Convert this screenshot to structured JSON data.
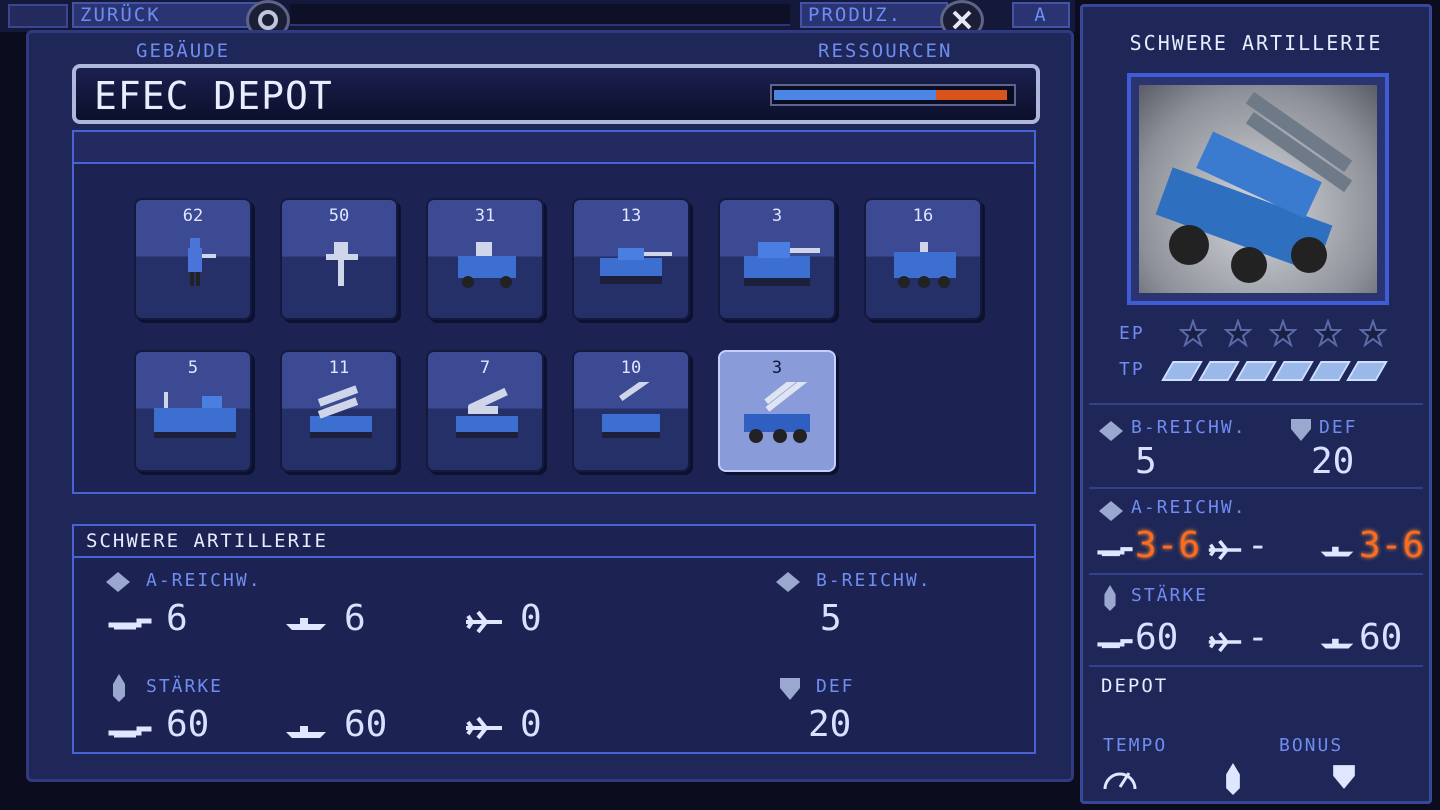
{
  "topbar": {
    "back_label": "ZURÜCK",
    "prod_label": "PRODUZ.",
    "a_label": "A"
  },
  "header": {
    "gebaeude_label": "GEBÄUDE",
    "ressourcen_label": "RESSOURCEN",
    "building_name": "EFEC DEPOT",
    "resource_blue_fraction": 0.68,
    "resource_orange_fraction": 0.3
  },
  "units": [
    {
      "count": "62",
      "type": "infantry"
    },
    {
      "count": "50",
      "type": "mech-infantry"
    },
    {
      "count": "31",
      "type": "jeep"
    },
    {
      "count": "13",
      "type": "light-tank"
    },
    {
      "count": "3",
      "type": "tank"
    },
    {
      "count": "16",
      "type": "apc"
    },
    {
      "count": "5",
      "type": "rocket-truck"
    },
    {
      "count": "11",
      "type": "multi-launcher"
    },
    {
      "count": "7",
      "type": "missile-tank"
    },
    {
      "count": "10",
      "type": "artillery"
    },
    {
      "count": "3",
      "type": "heavy-artillery",
      "selected": true
    }
  ],
  "detail": {
    "title": "SCHWERE ARTILLERIE",
    "a_range_label": "A-REICHW.",
    "a_range_ground": "6",
    "a_range_sea": "6",
    "a_range_air": "0",
    "b_range_label": "B-REICHW.",
    "b_range_value": "5",
    "strength_label": "STÄRKE",
    "strength_ground": "60",
    "strength_sea": "60",
    "strength_air": "0",
    "def_label": "DEF",
    "def_value": "20"
  },
  "right": {
    "title": "SCHWERE ARTILLERIE",
    "ep_label": "EP",
    "ep_stars": 5,
    "tp_label": "TP",
    "tp_segments": 6,
    "b_range_label": "B-REICHW.",
    "b_range_value": "5",
    "def_label": "DEF",
    "def_value": "20",
    "a_range_label": "A-REICHW.",
    "a_range_ground": "3-6",
    "a_range_air": "-",
    "a_range_sea": "3-6",
    "strength_label": "STÄRKE",
    "strength_ground": "60",
    "strength_air": "-",
    "strength_sea": "60",
    "depot_label": "DEPOT",
    "tempo_label": "TEMPO",
    "bonus_label": "BONUS"
  },
  "colors": {
    "accent": "#6f8cf0",
    "panel": "#1f2658",
    "orange": "#ff6a1e",
    "selected": "#8a9bd9"
  }
}
